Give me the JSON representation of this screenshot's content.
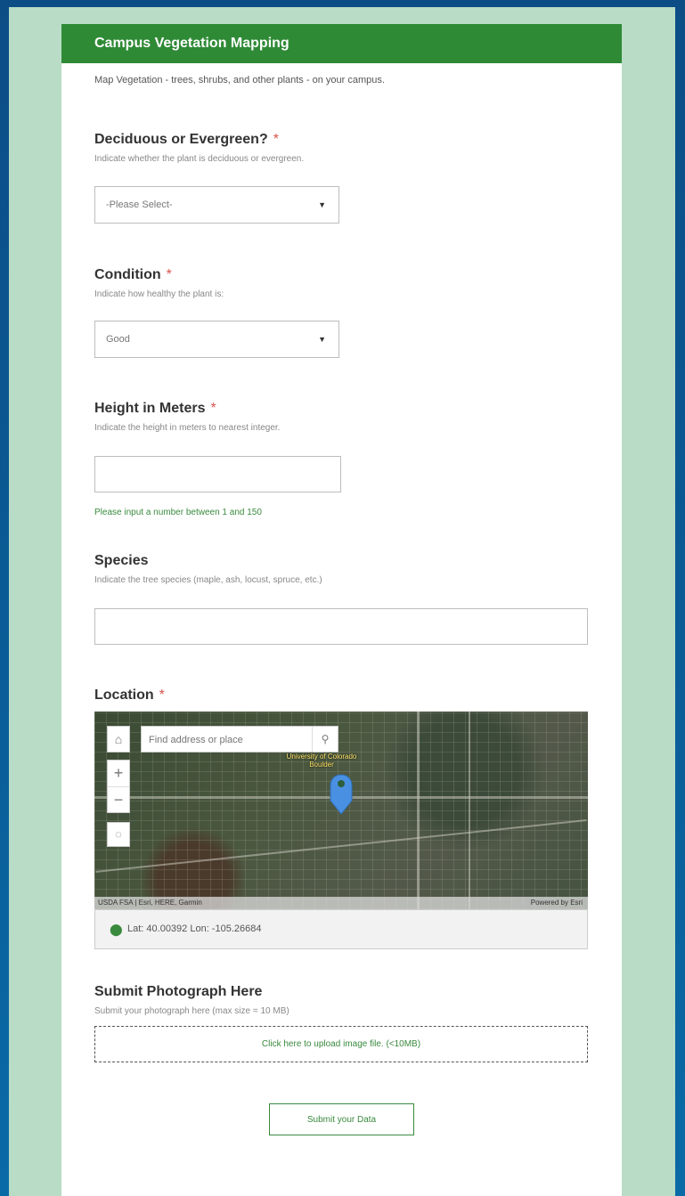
{
  "form": {
    "title": "Campus Vegetation Mapping",
    "description": "Map Vegetation - trees, shrubs, and other plants - on your campus."
  },
  "questions": {
    "deciduous": {
      "title": "Deciduous or Evergreen?",
      "required_mark": "*",
      "hint": "Indicate whether the plant is deciduous or evergreen.",
      "value": "-Please Select-"
    },
    "condition": {
      "title": "Condition",
      "required_mark": "*",
      "hint": "Indicate how healthy the plant is:",
      "value": "Good"
    },
    "height": {
      "title": "Height in Meters",
      "required_mark": "*",
      "hint": "Indicate the height in meters to nearest integer.",
      "value": "",
      "validation": "Please input a number between 1 and 150"
    },
    "species": {
      "title": "Species",
      "hint": "Indicate the tree species (maple, ash, locust, spruce, etc.)",
      "value": ""
    },
    "location": {
      "title": "Location",
      "required_mark": "*",
      "map": {
        "search_placeholder": "Find address or place",
        "place_label": "University of Colorado Boulder",
        "attribution": "USDA FSA | Esri, HERE, Garmin",
        "powered_by": "Powered by Esri"
      },
      "coordinates": "Lat: 40.00392  Lon: -105.26684"
    },
    "photo": {
      "title": "Submit Photograph Here",
      "hint": "Submit your photograph here (max size = 10 MB)",
      "upload_label": "Click here to upload image file. (<10MB)"
    }
  },
  "submit_label": "Submit your Data",
  "colors": {
    "header": "#2f8a36",
    "panel": "#b9dcc6",
    "accent": "#3a8a3e",
    "required": "#d9534f"
  }
}
